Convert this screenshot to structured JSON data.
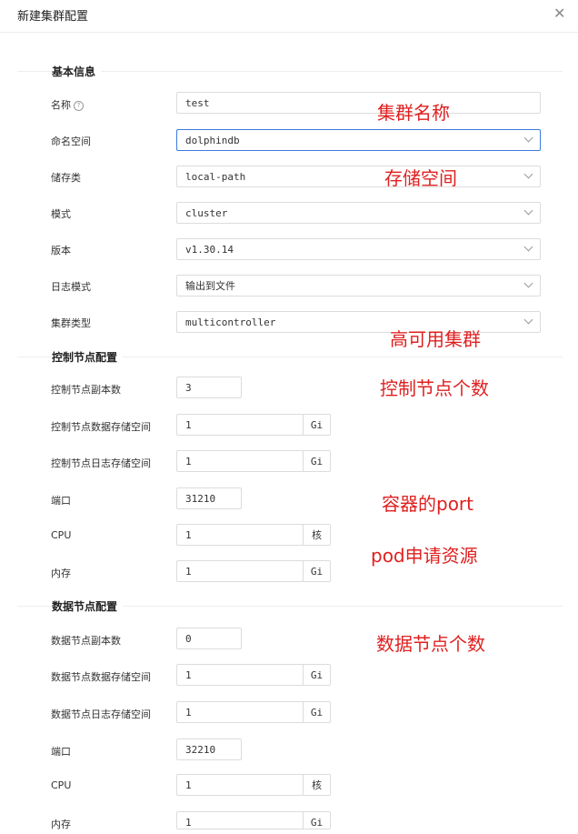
{
  "dialog": {
    "title": "新建集群配置",
    "close_icon": "close-icon"
  },
  "basic": {
    "section_title": "基本信息",
    "name": {
      "label": "名称",
      "value": "test"
    },
    "namespace": {
      "label": "命名空间",
      "value": "dolphindb"
    },
    "storage_class": {
      "label": "储存类",
      "value": "local-path"
    },
    "mode": {
      "label": "模式",
      "value": "cluster"
    },
    "version": {
      "label": "版本",
      "value": "v1.30.14"
    },
    "log_mode": {
      "label": "日志模式",
      "value": "输出到文件"
    },
    "cluster_type": {
      "label": "集群类型",
      "value": "multicontroller"
    }
  },
  "controller": {
    "section_title": "控制节点配置",
    "replicas": {
      "label": "控制节点副本数",
      "value": "3"
    },
    "data_storage": {
      "label": "控制节点数据存储空间",
      "value": "1",
      "unit": "Gi"
    },
    "log_storage": {
      "label": "控制节点日志存储空间",
      "value": "1",
      "unit": "Gi"
    },
    "port": {
      "label": "端口",
      "value": "31210"
    },
    "cpu": {
      "label": "CPU",
      "value": "1",
      "unit": "核"
    },
    "memory": {
      "label": "内存",
      "value": "1",
      "unit": "Gi"
    }
  },
  "datanode": {
    "section_title": "数据节点配置",
    "replicas": {
      "label": "数据节点副本数",
      "value": "0"
    },
    "data_storage": {
      "label": "数据节点数据存储空间",
      "value": "1",
      "unit": "Gi"
    },
    "log_storage": {
      "label": "数据节点日志存储空间",
      "value": "1",
      "unit": "Gi"
    },
    "port": {
      "label": "端口",
      "value": "32210"
    },
    "cpu": {
      "label": "CPU",
      "value": "1",
      "unit": "核"
    },
    "memory": {
      "label": "内存",
      "value": "1",
      "unit": "Gi"
    }
  },
  "annotations": {
    "cluster_name": "集群名称",
    "storage_space": "存储空间",
    "ha_cluster": "高可用集群",
    "controller_count": "控制节点个数",
    "container_port": "容器的port",
    "pod_resources": "pod申请资源",
    "datanode_count": "数据节点个数",
    "color": "#e02020"
  },
  "colors": {
    "focus_border": "#3c7be0",
    "input_border": "#dcdcdc"
  }
}
